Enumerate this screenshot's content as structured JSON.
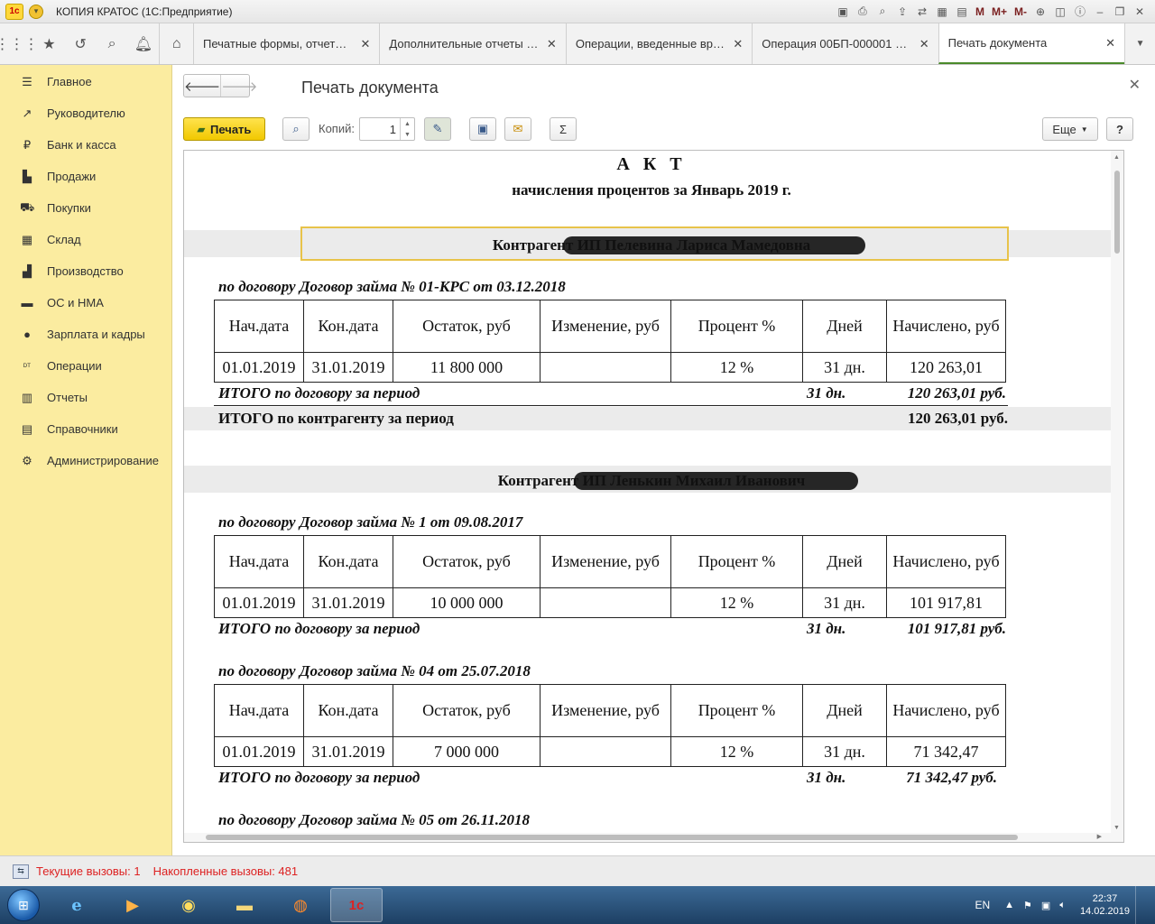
{
  "window": {
    "app_title": "КОПИЯ КРАТОС (1С:Предприятие)",
    "titlebar_buttons": [
      "M",
      "M+",
      "M-"
    ]
  },
  "tabs": [
    {
      "label": "Печатные формы, отчеты и ...",
      "active": false
    },
    {
      "label": "Дополнительные отчеты и о...",
      "active": false
    },
    {
      "label": "Операции, введенные вруч...",
      "active": false
    },
    {
      "label": "Операция 00БП-000001 от 3...",
      "active": false
    },
    {
      "label": "Печать документа",
      "active": true
    }
  ],
  "sidebar": {
    "items": [
      {
        "label": "Главное",
        "icon": "menu-icon"
      },
      {
        "label": "Руководителю",
        "icon": "trend-icon"
      },
      {
        "label": "Банк и касса",
        "icon": "ruble-icon"
      },
      {
        "label": "Продажи",
        "icon": "bag-icon"
      },
      {
        "label": "Покупки",
        "icon": "cart-icon"
      },
      {
        "label": "Склад",
        "icon": "grid-icon"
      },
      {
        "label": "Производство",
        "icon": "factory-icon"
      },
      {
        "label": "ОС и НМА",
        "icon": "truck-icon"
      },
      {
        "label": "Зарплата и кадры",
        "icon": "person-icon"
      },
      {
        "label": "Операции",
        "icon": "dt-kt-icon"
      },
      {
        "label": "Отчеты",
        "icon": "bar-chart-icon"
      },
      {
        "label": "Справочники",
        "icon": "book-icon"
      },
      {
        "label": "Администрирование",
        "icon": "gear-icon"
      }
    ]
  },
  "form": {
    "title": "Печать документа",
    "print_label": "Печать",
    "copies_label": "Копий:",
    "copies_value": "1",
    "more_label": "Еще",
    "help_label": "?",
    "sigma_label": "Σ"
  },
  "document": {
    "title": "А К Т",
    "subtitle": "начисления процентов за Январь 2019 г.",
    "columns": [
      "Нач.дата",
      "Кон.дата",
      "Остаток, руб",
      "Изменение, руб",
      "Процент %",
      "Дней",
      "Начислено, руб"
    ],
    "total_contract_label": "ИТОГО  по договору за период",
    "total_counterparty_label": "ИТОГО  по контрагенту за период",
    "counterparties": [
      {
        "name": "Контрагент ИП Пелевина Лариса Мамедовна",
        "contracts": [
          {
            "title": "по договору Договор займа № 01-КРС от 03.12.2018",
            "row": [
              "01.01.2019",
              "31.01.2019",
              "11 800 000",
              "",
              "12 %",
              "31 дн.",
              "120 263,01"
            ],
            "total_days": "31 дн.",
            "total_sum": "120 263,01 руб."
          }
        ],
        "total_sum": "120 263,01 руб."
      },
      {
        "name": "Контрагент ИП  Ленькин Михаил Иванович",
        "contracts": [
          {
            "title": "по договору Договор займа № 1 от 09.08.2017",
            "row": [
              "01.01.2019",
              "31.01.2019",
              "10 000 000",
              "",
              "12 %",
              "31 дн.",
              "101 917,81"
            ],
            "total_days": "31 дн.",
            "total_sum": "101 917,81 руб."
          },
          {
            "title": "по договору Договор займа № 04 от 25.07.2018",
            "row": [
              "01.01.2019",
              "31.01.2019",
              "7 000 000",
              "",
              "12 %",
              "31 дн.",
              "71 342,47"
            ],
            "total_days": "31 дн.",
            "total_sum": "71 342,47 руб."
          },
          {
            "title": "по договору Договор займа № 05 от 26.11.2018"
          }
        ]
      }
    ]
  },
  "statusbar": {
    "current_calls": "Текущие вызовы: 1",
    "accumulated_calls": "Накопленные вызовы: 481"
  },
  "taskbar": {
    "lang": "EN",
    "time": "22:37",
    "date": "14.02.2019"
  }
}
